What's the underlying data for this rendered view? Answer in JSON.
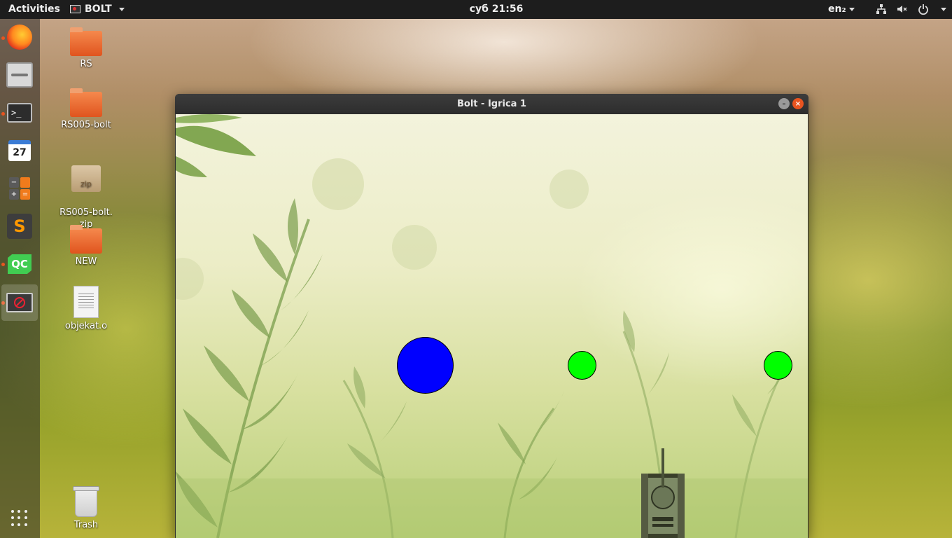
{
  "topbar": {
    "activities": "Activities",
    "app_menu": "BOLT",
    "clock": "суб 21:56",
    "language": "en₂"
  },
  "dock": {
    "items": [
      "firefox-icon",
      "files-icon",
      "terminal-icon",
      "calendar-icon",
      "calculator-icon",
      "sublime-text-icon",
      "qt-creator-icon",
      "bolt-app-icon"
    ],
    "calendar_day": "27",
    "qc_label": "QC",
    "sublime_glyph": "S",
    "terminal_glyph": ">_"
  },
  "desktop": {
    "icons": [
      {
        "label": "RS",
        "kind": "folder"
      },
      {
        "label": "RS005-bolt",
        "kind": "folder"
      },
      {
        "label": "RS005-bolt.\nzip",
        "kind": "zip"
      },
      {
        "label": "NEW",
        "kind": "folder"
      },
      {
        "label": "objekat.o",
        "kind": "file"
      },
      {
        "label": "Trash",
        "kind": "trash"
      }
    ],
    "zip_badge": "zip"
  },
  "window": {
    "title": "Bolt - Igrica 1",
    "minimize_glyph": "–",
    "close_glyph": "×"
  },
  "game": {
    "balls": [
      {
        "color": "#0000ff",
        "role": "large-ball"
      },
      {
        "color": "#00ff00",
        "role": "small-ball"
      },
      {
        "color": "#00ff00",
        "role": "small-ball"
      }
    ],
    "player": "tank"
  }
}
